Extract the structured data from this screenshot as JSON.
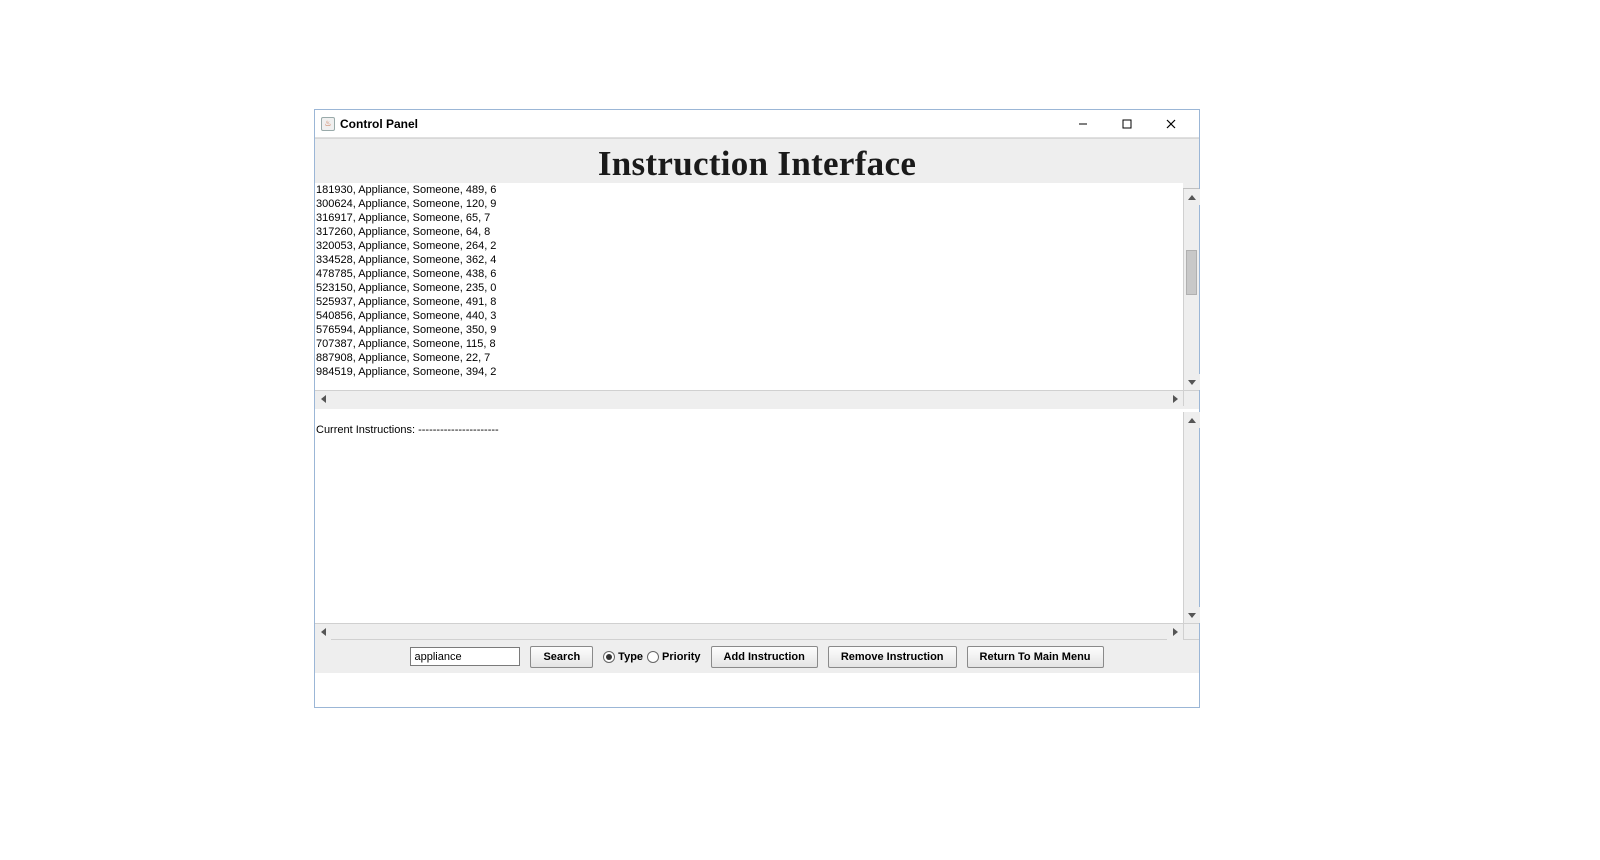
{
  "window": {
    "title": "Control Panel"
  },
  "header": {
    "title": "Instruction Interface"
  },
  "upper_text": "181930, Appliance, Someone, 489, 6\n300624, Appliance, Someone, 120, 9\n316917, Appliance, Someone, 65, 7\n317260, Appliance, Someone, 64, 8\n320053, Appliance, Someone, 264, 2\n334528, Appliance, Someone, 362, 4\n478785, Appliance, Someone, 438, 6\n523150, Appliance, Someone, 235, 0\n525937, Appliance, Someone, 491, 8\n540856, Appliance, Someone, 440, 3\n576594, Appliance, Someone, 350, 9\n707387, Appliance, Someone, 115, 8\n887908, Appliance, Someone, 22, 7\n984519, Appliance, Someone, 394, 2",
  "lower_text": "Current Instructions: ----------------------",
  "toolbar": {
    "search_value": "appliance",
    "search_button": "Search",
    "radio_type": "Type",
    "radio_priority": "Priority",
    "radio_selected": "type",
    "add_button": "Add Instruction",
    "remove_button": "Remove Instruction",
    "return_button": "Return To Main Menu"
  }
}
